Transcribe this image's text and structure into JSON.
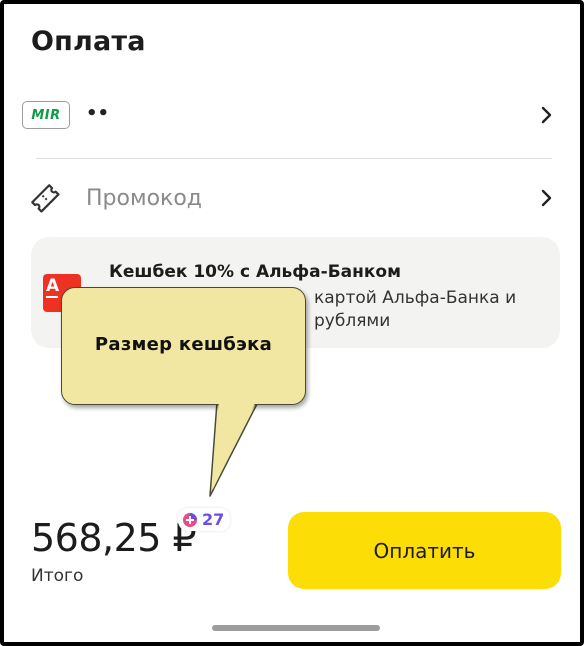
{
  "header": {
    "title": "Оплата"
  },
  "payment_method": {
    "brand": "MIR",
    "card_mask": "••",
    "icon": "chevron-right-icon"
  },
  "promo": {
    "label": "Промокод",
    "icon": "ticket-icon"
  },
  "cashback": {
    "title": "Кешбек 10% с Альфа-Банком",
    "description": "картой Альфа-Банка и рублями",
    "bank_logo": "А"
  },
  "annotation": {
    "text": "Размер кешбэка"
  },
  "footer": {
    "price": "568,25 ₽",
    "total_label": "Итого",
    "cashback_points": "27",
    "pay_button": "Оплатить"
  },
  "colors": {
    "accent": "#fddd06",
    "points": "#6a4de8",
    "mir_green": "#0f9a47",
    "alfa_red": "#ef3124"
  }
}
